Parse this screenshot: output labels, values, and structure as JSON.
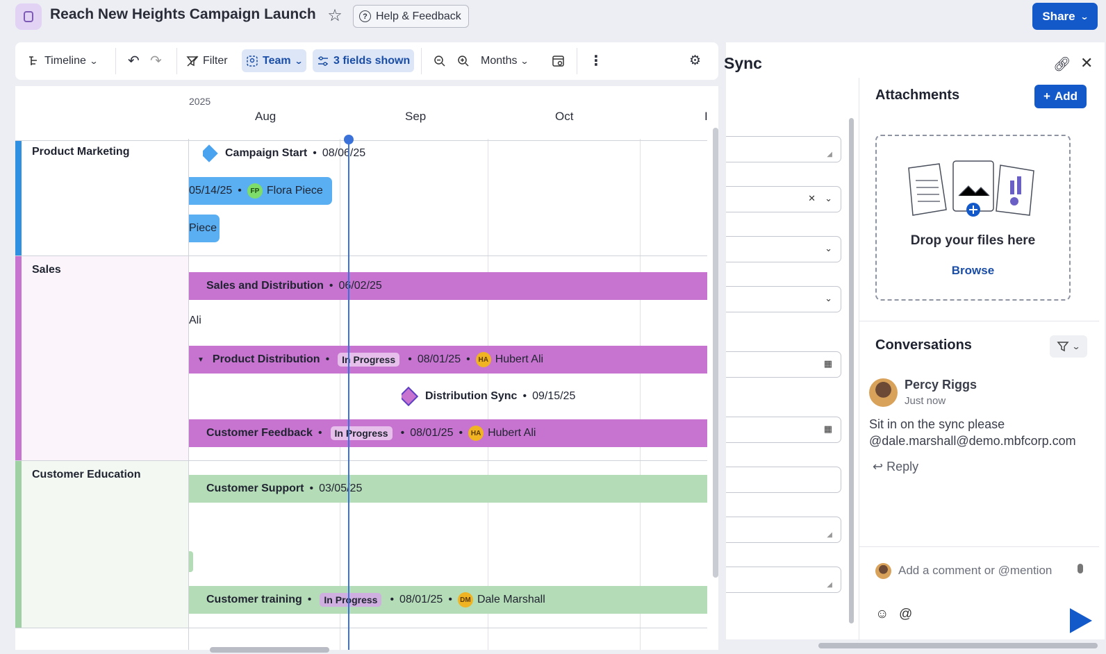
{
  "header": {
    "title": "Reach New Heights Campaign Launch",
    "help_label": "Help & Feedback",
    "share_label": "Share"
  },
  "toolbar": {
    "view_label": "Timeline",
    "filter_label": "Filter",
    "team_label": "Team",
    "fields_label": "3 fields shown",
    "scale_label": "Months"
  },
  "timeline": {
    "year": "2025",
    "months": [
      "Aug",
      "Sep",
      "Oct"
    ],
    "groups": [
      {
        "label": "Product Marketing",
        "color": "#2f8fe0"
      },
      {
        "label": "Sales",
        "color": "#c774d0"
      },
      {
        "label": "Customer Education",
        "color": "#9fd0a3"
      }
    ],
    "items": {
      "campaign_start_name": "Campaign Start",
      "campaign_start_date": "08/06/25",
      "flora_date": "05/14/25",
      "flora_initials": "FP",
      "flora_name": "Flora Piece",
      "piece_text": "Piece",
      "sales_dist_name": "Sales and Distribution",
      "sales_dist_date": "06/02/25",
      "ali_text": "Ali",
      "prod_dist_name": "Product Distribution",
      "prod_dist_status": "In Progress",
      "prod_dist_date": "08/01/25",
      "prod_dist_initials": "HA",
      "prod_dist_owner": "Hubert Ali",
      "dist_sync_name": "Distribution Sync",
      "dist_sync_date": "09/15/25",
      "cust_feedback_name": "Customer Feedback",
      "cust_feedback_status": "In Progress",
      "cust_feedback_date": "08/01/25",
      "cust_feedback_initials": "HA",
      "cust_feedback_owner": "Hubert Ali",
      "cust_support_name": "Customer Support",
      "cust_support_date": "03/05/25",
      "cust_training_name": "Customer training",
      "cust_training_status": "In Progress",
      "cust_training_date": "08/01/25",
      "cust_training_initials": "DM",
      "cust_training_owner": "Dale Marshall",
      "separator": "•"
    }
  },
  "side_panel": {
    "title_fragment": "ync",
    "attachments_title": "Attachments",
    "add_label": "Add",
    "drop_text": "Drop your files here",
    "browse_label": "Browse",
    "conversations_title": "Conversations",
    "comment": {
      "author": "Percy Riggs",
      "time": "Just now",
      "text_line1": "Sit in on the sync please",
      "text_line2": "@dale.marshall@demo.mbfcorp.com",
      "reply_label": "Reply"
    },
    "comment_placeholder": "Add a comment or @mention"
  }
}
